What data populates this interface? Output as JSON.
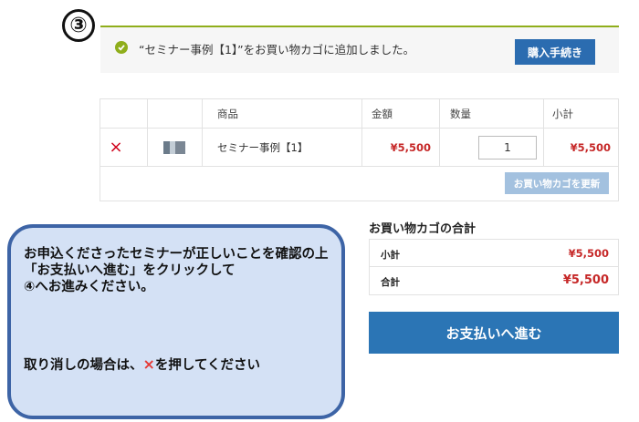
{
  "step": {
    "number": "③"
  },
  "notice": {
    "message": "“セミナー事例【1】”をお買い物カゴに追加しました。",
    "checkout_label": "購入手続き"
  },
  "cart": {
    "headers": {
      "product": "商品",
      "price": "金額",
      "quantity": "数量",
      "subtotal": "小計"
    },
    "items": [
      {
        "remove": "×",
        "name": "セミナー事例【1】",
        "price": "¥5,500",
        "quantity": "1",
        "subtotal": "¥5,500"
      }
    ],
    "update_label": "お買い物カゴを更新"
  },
  "totals": {
    "title": "お買い物カゴの合計",
    "subtotal_label": "小計",
    "subtotal_value": "¥5,500",
    "total_label": "合計",
    "total_value": "¥5,500"
  },
  "proceed_label": "お支払いへ進む",
  "callout": {
    "text1": "お申込くださったセミナーが正しいことを確認の上「お支払いへ進む」をクリックして\n④へお進みください。",
    "text2_before": "取り消しの場合は、",
    "text2_mark": "×",
    "text2_after": "を押してください"
  },
  "colors": {
    "accent_green": "#8fae1b",
    "button_blue": "#2b6cb0",
    "price_red": "#c62828",
    "callout_bg": "#d4e1f5",
    "callout_border": "#3d64a6"
  }
}
